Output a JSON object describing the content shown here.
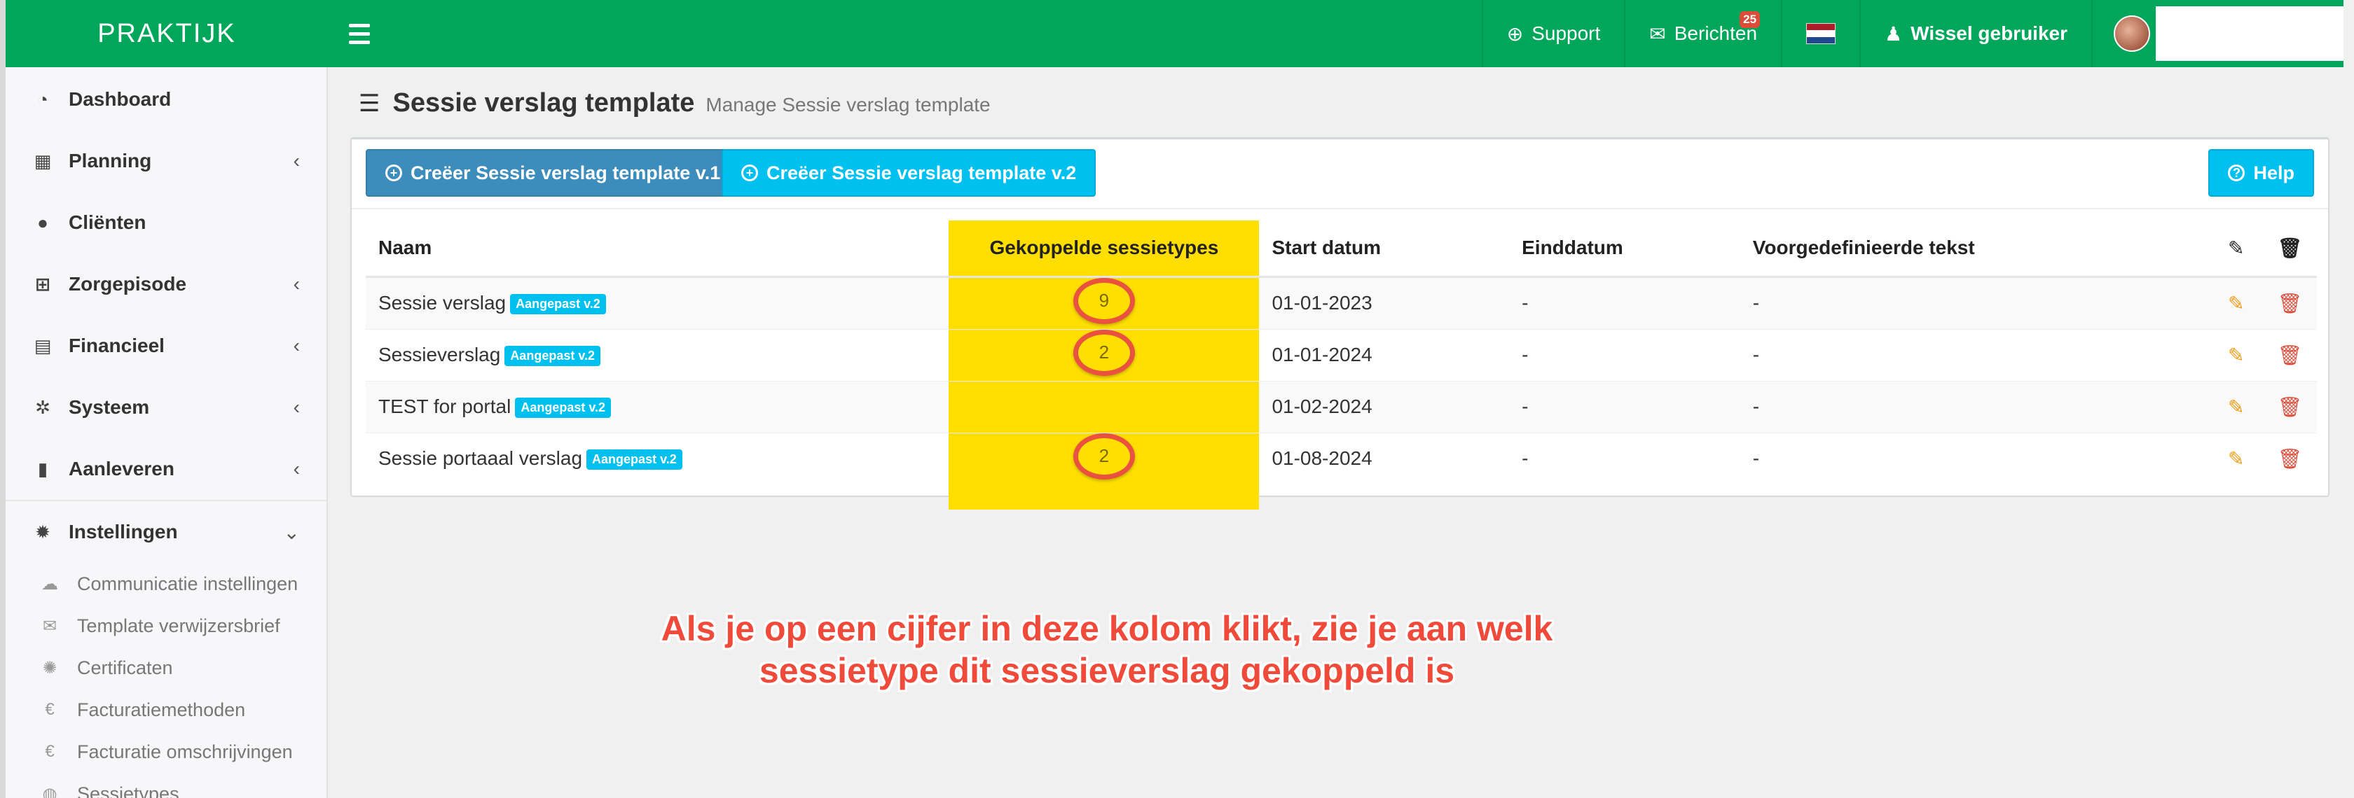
{
  "brand": "PRAKTIJK",
  "topnav": {
    "support": "Support",
    "berichten": "Berichten",
    "berichten_count": "25",
    "wissel": "Wissel gebruiker"
  },
  "colors": {
    "primary_green": "#00a65a",
    "blue": "#3c8dbc",
    "cyan": "#00c0ef",
    "highlight": "#ffde00",
    "annotation": "#f04a3a"
  },
  "sidebar": {
    "items": [
      {
        "label": "Dashboard",
        "icon": "dashboard-icon"
      },
      {
        "label": "Planning",
        "icon": "calendar-icon"
      },
      {
        "label": "Cliënten",
        "icon": "user-icon"
      },
      {
        "label": "Zorgepisode",
        "icon": "medkit-icon"
      },
      {
        "label": "Financieel",
        "icon": "book-icon"
      },
      {
        "label": "Systeem",
        "icon": "cogs-icon"
      },
      {
        "label": "Aanleveren",
        "icon": "truck-icon"
      },
      {
        "label": "Instellingen",
        "icon": "gear-icon"
      }
    ],
    "subitems": [
      {
        "label": "Communicatie instellingen",
        "icon": "comments-icon"
      },
      {
        "label": "Template verwijzersbrief",
        "icon": "envelope-icon"
      },
      {
        "label": "Certificaten",
        "icon": "certificate-icon"
      },
      {
        "label": "Facturatiemethoden",
        "icon": "euro-icon"
      },
      {
        "label": "Facturatie omschrijvingen",
        "icon": "euro-icon"
      },
      {
        "label": "Sessietypes",
        "icon": "globe-icon"
      }
    ]
  },
  "page": {
    "title": "Sessie verslag template",
    "subtitle": "Manage Sessie verslag template",
    "btn_create_v1": "Creëer Sessie verslag template v.1",
    "btn_create_v2": "Creëer Sessie verslag template v.2",
    "btn_help": "Help"
  },
  "table": {
    "headers": [
      "Naam",
      "Gekoppelde sessietypes",
      "Start datum",
      "Einddatum",
      "Voorgedefinieerde tekst"
    ],
    "rows": [
      {
        "name": "Sessie verslag",
        "tag": "Aangepast v.2",
        "count": "9",
        "start": "01-01-2023",
        "end": "-",
        "text": "-"
      },
      {
        "name": "Sessieverslag",
        "tag": "Aangepast v.2",
        "count": "2",
        "start": "01-01-2024",
        "end": "-",
        "text": "-"
      },
      {
        "name": "TEST for portal",
        "tag": "Aangepast v.2",
        "count": "",
        "start": "01-02-2024",
        "end": "-",
        "text": "-"
      },
      {
        "name": "Sessie portaaal verslag",
        "tag": "Aangepast v.2",
        "count": "2",
        "start": "01-08-2024",
        "end": "-",
        "text": "-"
      }
    ]
  },
  "annotation": {
    "line1": "Als je op een cijfer in deze kolom klikt, zie je aan welk",
    "line2": "sessietype dit sessieverslag gekoppeld is"
  }
}
